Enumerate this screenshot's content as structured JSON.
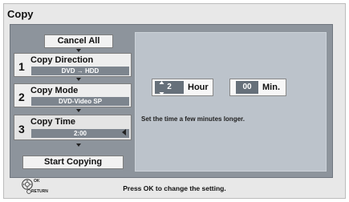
{
  "screen": {
    "title": "Copy"
  },
  "menu": {
    "cancel_all": "Cancel All",
    "steps": [
      {
        "number": "1",
        "title": "Copy Direction",
        "value": "DVD → HDD"
      },
      {
        "number": "2",
        "title": "Copy Mode",
        "value": "DVD-Video SP"
      },
      {
        "number": "3",
        "title": "Copy Time",
        "value": "2:00"
      }
    ],
    "start_copying": "Start Copying"
  },
  "time": {
    "hour_value": "2",
    "hour_label": "Hour",
    "min_value": "00",
    "min_label": "Min.",
    "hint": "Set the time a few minutes longer."
  },
  "footer": {
    "ok_label": "OK",
    "return_label": "RETURN",
    "message": "Press OK to change the setting."
  }
}
